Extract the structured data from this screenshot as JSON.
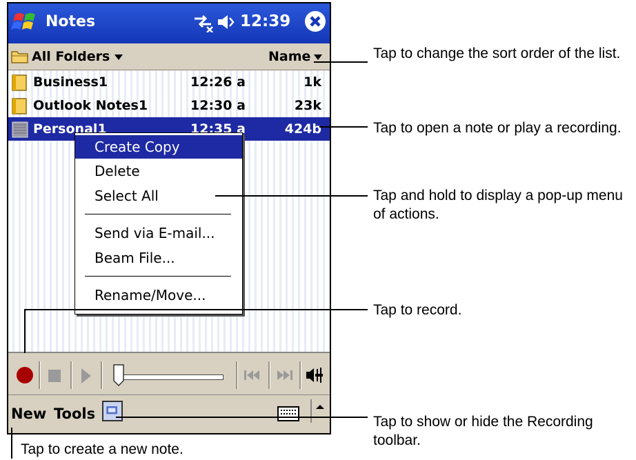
{
  "titlebar": {
    "app_title": "Notes",
    "clock": "12:39"
  },
  "folderbar": {
    "folder_label": "All Folders",
    "sort_label": "Name"
  },
  "notes": [
    {
      "name": "Business1",
      "time": "12:26 a",
      "size": "1k",
      "icon": "note-folder-icon",
      "selected": false
    },
    {
      "name": "Outlook Notes1",
      "time": "12:30 a",
      "size": "23k",
      "icon": "note-folder-icon",
      "selected": false
    },
    {
      "name": "Personal1",
      "time": "12:35 a",
      "size": "424b",
      "icon": "recording-note-icon",
      "selected": true
    }
  ],
  "context_menu": {
    "items": [
      "Create Copy",
      "Delete",
      "Select All",
      "Send via E-mail...",
      "Beam File...",
      "Rename/Move..."
    ],
    "highlighted": "Create Copy"
  },
  "menubar": {
    "new_label": "New",
    "tools_label": "Tools"
  },
  "callouts": {
    "sort": "Tap to change the sort order of the list.",
    "open": "Tap to open a note or play a recording.",
    "hold": "Tap and hold to display a pop-up menu of actions.",
    "record": "Tap to record.",
    "toggle": "Tap to show or hide the Recording toolbar.",
    "new_note": "Tap to create a new note."
  },
  "colors": {
    "titlebar": "#1e3fc4",
    "selection": "#1e2aa3",
    "bar": "#d8d0c0",
    "record": "#a80000"
  }
}
